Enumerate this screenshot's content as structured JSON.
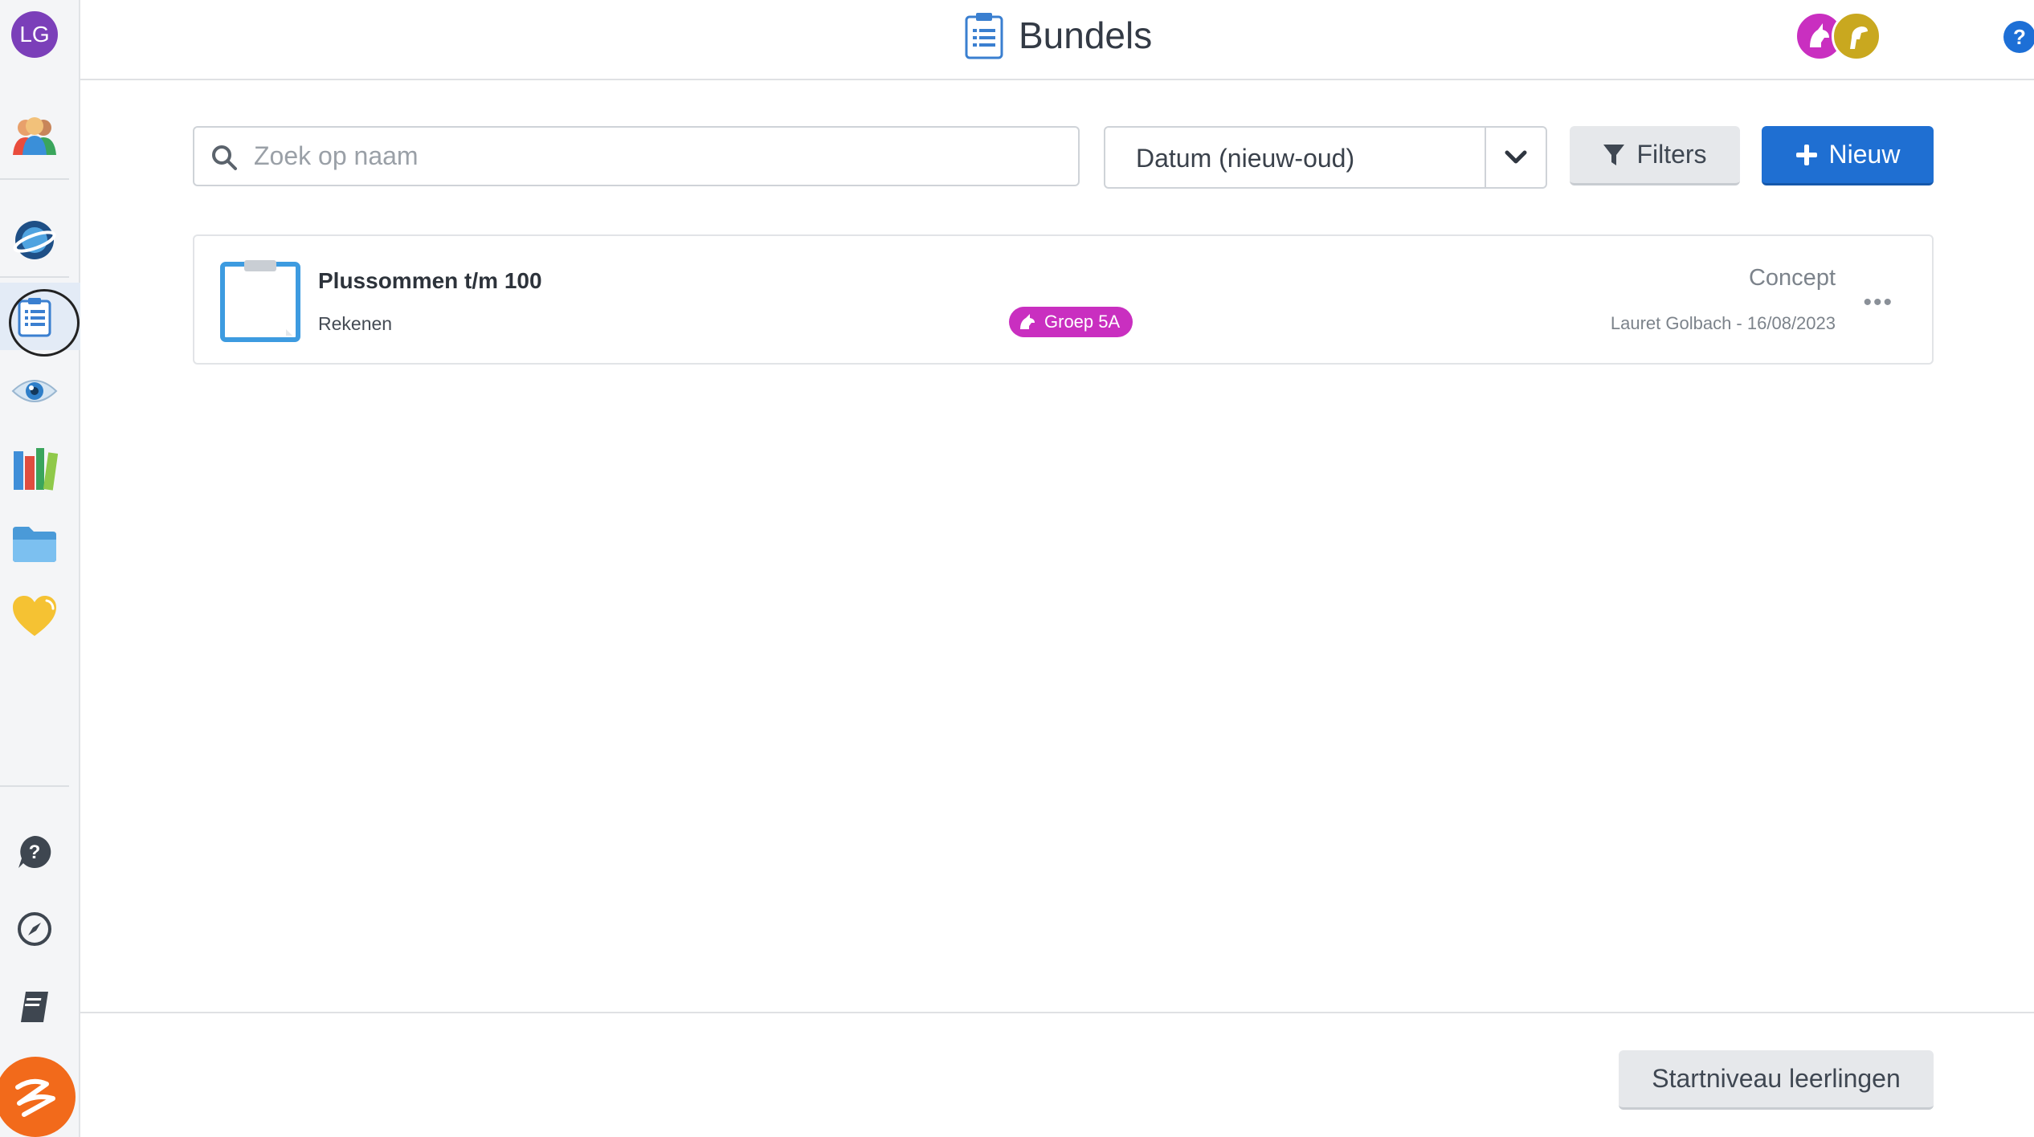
{
  "user": {
    "initials": "LG"
  },
  "header": {
    "title": "Bundels",
    "help": "?"
  },
  "toolbar": {
    "search_placeholder": "Zoek op naam",
    "sort_value": "Datum (nieuw-oud)",
    "filters_label": "Filters",
    "new_label": "Nieuw"
  },
  "bundles": [
    {
      "name": "Plussommen t/m 100",
      "subject": "Rekenen",
      "group": "Groep 5A",
      "status": "Concept",
      "author": "Lauret Golbach -",
      "date": "16/08/2023"
    }
  ],
  "footer": {
    "start_label": "Startniveau leerlingen"
  },
  "colors": {
    "accent": "#1f6fd2",
    "group_tag": "#c92fc0",
    "avatar": "#7b3fb9",
    "brand": "#f26a1b"
  }
}
